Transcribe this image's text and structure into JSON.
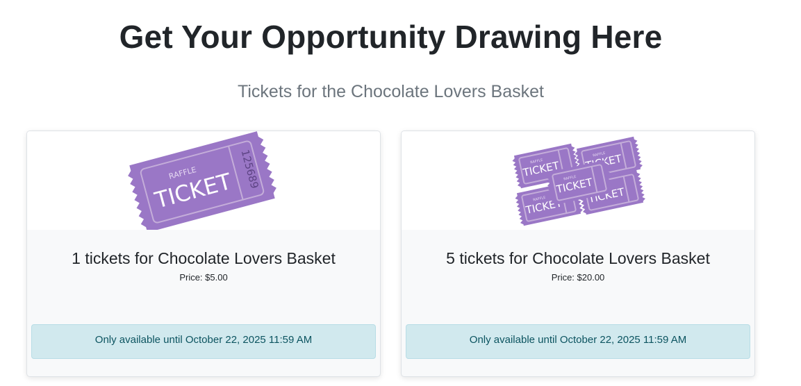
{
  "page": {
    "title": "Get Your Opportunity Drawing Here",
    "subtitle": "Tickets for the Chocolate Lovers Basket"
  },
  "products": [
    {
      "title": "1 tickets for Chocolate Lovers Basket",
      "price": "Price: $5.00",
      "availability": "Only available until October 22, 2025 11:59 AM",
      "image": {
        "icon": "single-raffle-ticket",
        "label_small": "RAFFLE",
        "label_big": "TICKET",
        "number": "125689",
        "color": "#9a77c6"
      }
    },
    {
      "title": "5 tickets for Chocolate Lovers Basket",
      "price": "Price: $20.00",
      "availability": "Only available until October 22, 2025 11:59 AM",
      "image": {
        "icon": "multiple-raffle-tickets",
        "label_small": "RAFFLE",
        "label_big": "TICKET",
        "color": "#9a77c6"
      }
    }
  ]
}
